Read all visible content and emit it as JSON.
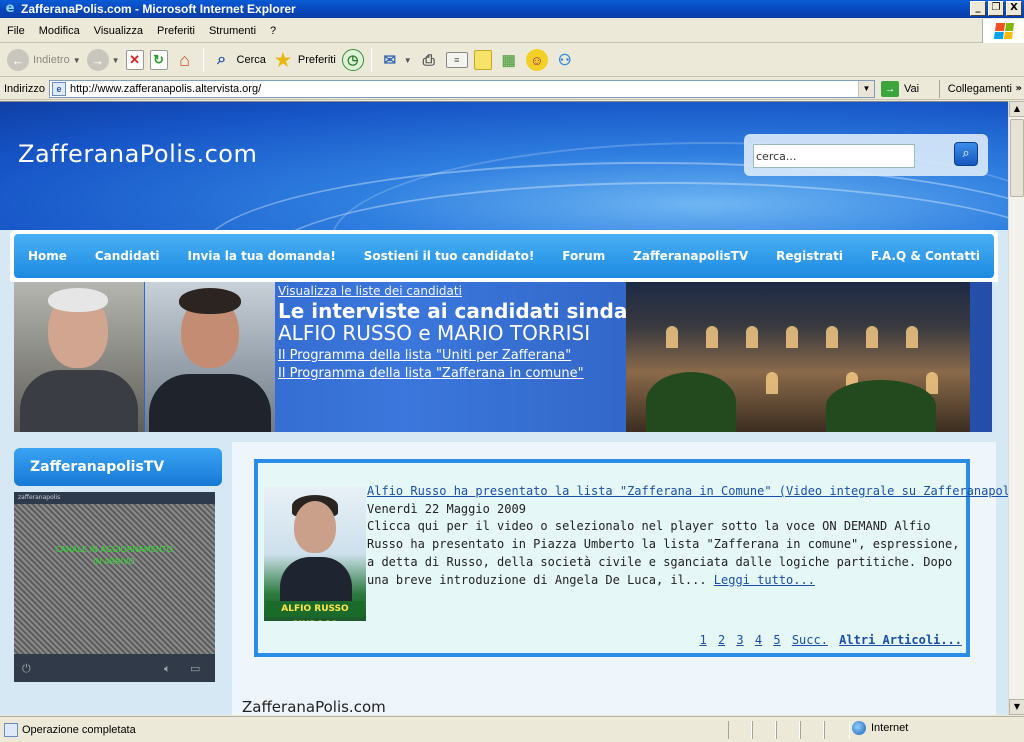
{
  "window": {
    "title": "ZafferanaPolis.com - Microsoft Internet Explorer",
    "minimize": "_",
    "maximize": "❐",
    "close": "X"
  },
  "menu": [
    "File",
    "Modifica",
    "Visualizza",
    "Preferiti",
    "Strumenti",
    "?"
  ],
  "toolbar": {
    "back": "Indietro",
    "search": "Cerca",
    "favorites": "Preferiti"
  },
  "address": {
    "label": "Indirizzo",
    "url": "http://www.zafferanapolis.altervista.org/",
    "go": "Vai",
    "links": "Collegamenti"
  },
  "site": {
    "title": "ZafferanaPolis.com",
    "search_placeholder": "cerca..."
  },
  "nav": [
    "Home",
    "Candidati",
    "Invia la tua domanda!",
    "Sostieni il tuo candidato!",
    "Forum",
    "ZafferanapolisTV",
    "Registrati",
    "F.A.Q & Contatti"
  ],
  "banner": {
    "top_link": "Visualizza le liste dei candidati",
    "headline": "Le interviste ai candidati sindaco",
    "names": "ALFIO RUSSO e MARIO TORRISI",
    "link1": "Il Programma della lista \"Uniti per Zafferana\"",
    "link2": "Il Programma della lista \"Zafferana in comune\""
  },
  "sidebar": {
    "tv_title": "ZafferanapolisTV",
    "tv_header": "zafferanapolis",
    "tv_message": "CANALE IN AGGIORNAMENTO\nIN ARRIVO"
  },
  "article": {
    "title": "Alfio Russo ha presentato la lista \"Zafferana in Comune\" (Video integrale su ZafferanapolisTV)",
    "date": "Venerdì 22 Maggio 2009",
    "body": " Clicca qui per il video o selezionalo nel player sotto la voce ON DEMAND  Alfio Russo ha presentato in Piazza Umberto la lista \"Zafferana in comune\", espressione, a detta di Russo, della società civile e sganciata dalle logiche partitiche. Dopo una breve introduzione di Angela De Luca, il...",
    "more": "Leggi tutto...",
    "thumb_caption": "ALFIO RUSSO SINDACO",
    "pages": [
      "1",
      "2",
      "3",
      "4",
      "5"
    ],
    "next": "Succ.",
    "other": "Altri Articoli..."
  },
  "footer": {
    "title": "ZafferanaPolis.com"
  },
  "status": {
    "text": "Operazione completata",
    "zone": "Internet"
  }
}
